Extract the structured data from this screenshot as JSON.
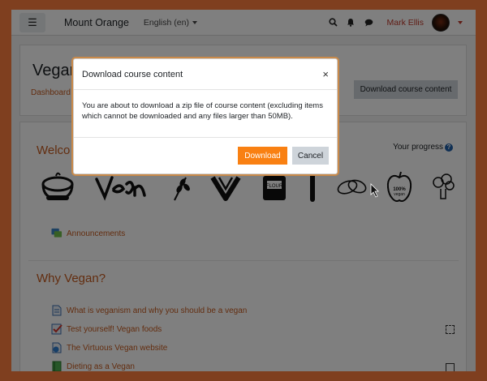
{
  "navbar": {
    "menu_icon": "hamburger-icon",
    "site_name": "Mount Orange",
    "language": "English (en)",
    "user_name": "Mark Ellis",
    "icons": [
      "search-icon",
      "bell-icon",
      "chat-icon"
    ]
  },
  "header": {
    "course_title": "Vegan",
    "breadcrumb": "Dashboard",
    "download_button": "Download course content"
  },
  "content": {
    "welcome_heading": "Welco",
    "progress_label": "Your progress",
    "announcements": "Announcements",
    "why_heading": "Why Vegan?",
    "activities": [
      {
        "label": "What is veganism and why you should be a vegan",
        "icon": "page-icon",
        "completion": "none"
      },
      {
        "label": "Test yourself! Vegan foods",
        "icon": "quiz-icon",
        "completion": "auto"
      },
      {
        "label": "The Virtuous Vegan website",
        "icon": "url-icon",
        "completion": "none"
      },
      {
        "label": "Dieting as a Vegan",
        "icon": "book-icon",
        "completion": "manual"
      }
    ]
  },
  "modal": {
    "title": "Download course content",
    "close_glyph": "×",
    "body": "You are about to download a zip file of course content (excluding items which cannot be downloaded and any files larger than 50MB).",
    "download_button": "Download",
    "cancel_button": "Cancel"
  },
  "colors": {
    "page_border": "#ff7f3f",
    "link": "#c65b1f",
    "primary": "#f98012",
    "secondary": "#ced4da"
  }
}
